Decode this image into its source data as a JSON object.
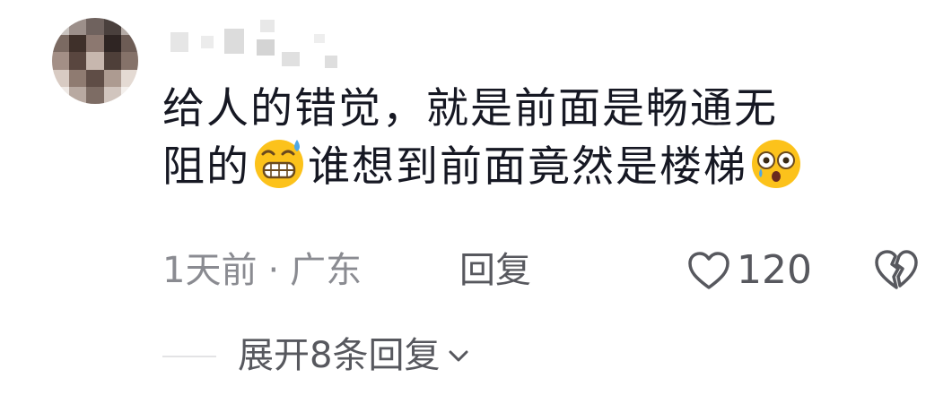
{
  "comment": {
    "line1": "给人的错觉，就是前面是畅通无",
    "line2_start": "阻的",
    "line2_mid": "谁想到前面竟然是楼梯",
    "emoji1": "grinning-sweat-emoji",
    "emoji2": "astonished-tear-emoji"
  },
  "meta": {
    "time": "1天前",
    "separator": "·",
    "location": "广东",
    "reply_label": "回复"
  },
  "actions": {
    "like_count": "120",
    "like_icon": "heart-outline-icon",
    "dislike_icon": "broken-heart-icon"
  },
  "replies": {
    "expand_label": "展开8条回复",
    "expand_icon": "chevron-down-icon"
  },
  "colors": {
    "text_primary": "#161823",
    "text_secondary": "#8a8b91",
    "text_action": "#57585e"
  }
}
